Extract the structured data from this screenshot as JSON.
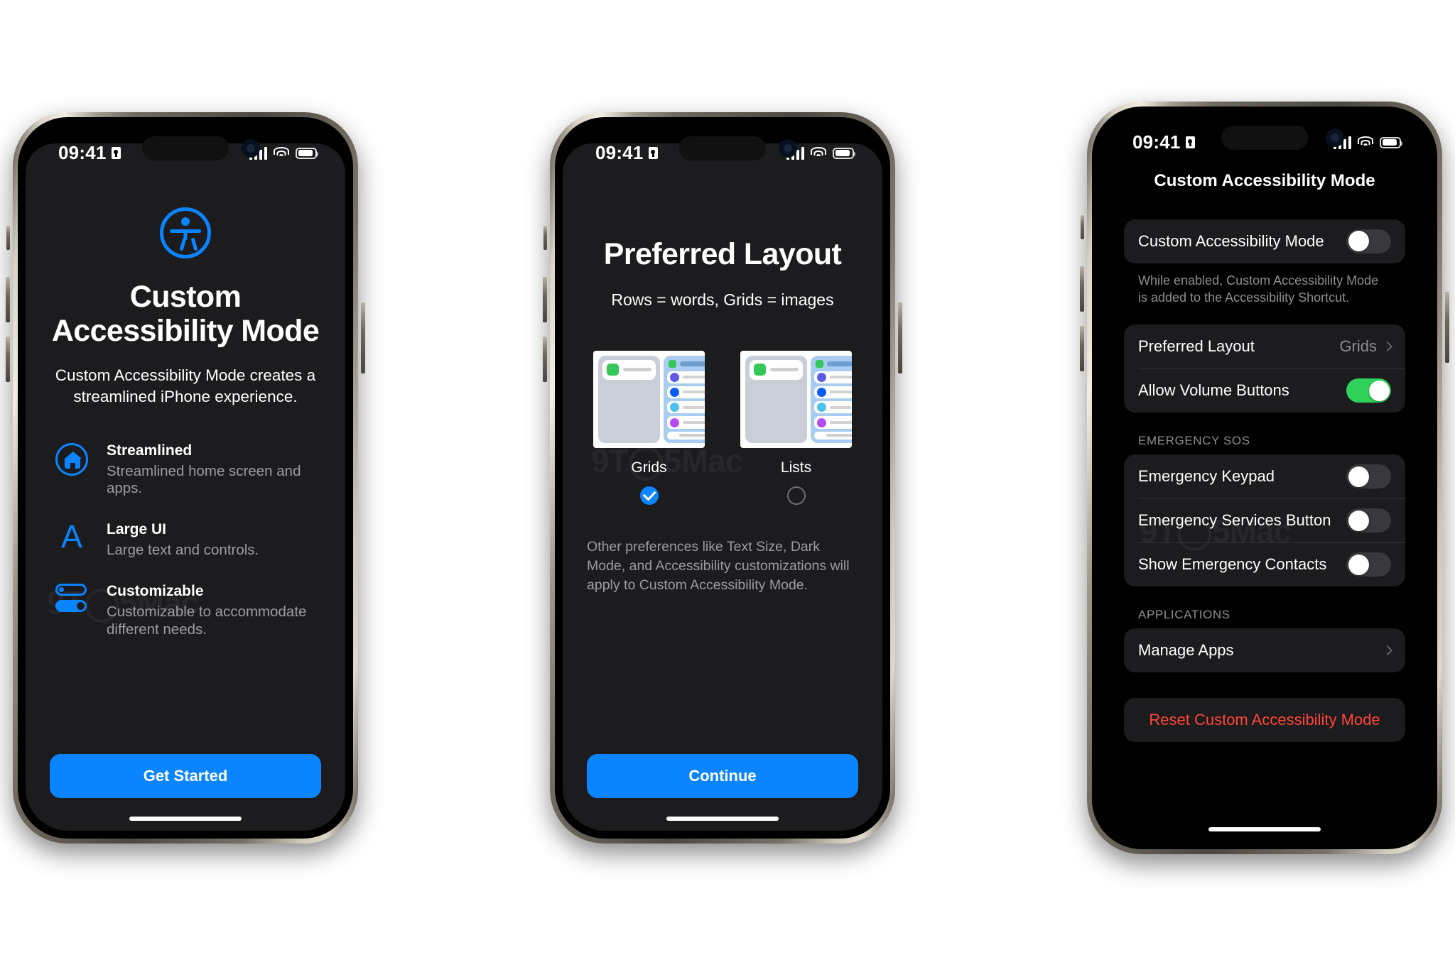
{
  "status_bar": {
    "time": "09:41",
    "lock_icon": "lock-portrait-icon",
    "signal_icon": "cellular-bars-icon",
    "wifi_icon": "wifi-icon",
    "battery_icon": "battery-icon"
  },
  "watermark": "9T◯5Mac",
  "screen1": {
    "hero_icon": "accessibility-icon",
    "title": "Custom Accessibility Mode",
    "subtitle": "Custom Accessibility Mode creates a streamlined iPhone experience.",
    "features": [
      {
        "icon": "home-circle-icon",
        "title": "Streamlined",
        "body": "Streamlined home screen and apps."
      },
      {
        "icon": "large-letter-a-icon",
        "title": "Large UI",
        "body": "Large text and controls."
      },
      {
        "icon": "toggles-icon",
        "title": "Customizable",
        "body": "Customizable to accommodate different needs."
      }
    ],
    "cta_label": "Get Started"
  },
  "screen2": {
    "title": "Preferred Layout",
    "subtitle": "Rows = words, Grids = images",
    "options": [
      {
        "label": "Grids",
        "selected": true
      },
      {
        "label": "Lists",
        "selected": false
      }
    ],
    "note": "Other preferences like Text Size, Dark Mode, and Accessibility customizations will apply to Custom Accessibility Mode.",
    "cta_label": "Continue"
  },
  "screen3": {
    "nav_title": "Custom Accessibility Mode",
    "group1": {
      "rows": [
        {
          "label": "Custom Accessibility Mode",
          "type": "toggle",
          "on": false
        }
      ],
      "footer": "While enabled, Custom Accessibility Mode is added to the Accessibility Shortcut."
    },
    "group2": {
      "rows": [
        {
          "label": "Preferred Layout",
          "type": "disclosure",
          "value": "Grids"
        },
        {
          "label": "Allow Volume Buttons",
          "type": "toggle",
          "on": true
        }
      ]
    },
    "section_emergency": "EMERGENCY SOS",
    "group3": {
      "rows": [
        {
          "label": "Emergency Keypad",
          "type": "toggle",
          "on": false
        },
        {
          "label": "Emergency Services Button",
          "type": "toggle",
          "on": false
        },
        {
          "label": "Show Emergency Contacts",
          "type": "toggle",
          "on": false
        }
      ]
    },
    "section_applications": "APPLICATIONS",
    "group4": {
      "rows": [
        {
          "label": "Manage Apps",
          "type": "disclosure",
          "value": ""
        }
      ]
    },
    "reset_label": "Reset Custom Accessibility Mode"
  },
  "colors": {
    "accent": "#0a84ff",
    "toggle_on": "#30d158",
    "destructive": "#ff453a",
    "sheet": "#1c1c1e"
  }
}
